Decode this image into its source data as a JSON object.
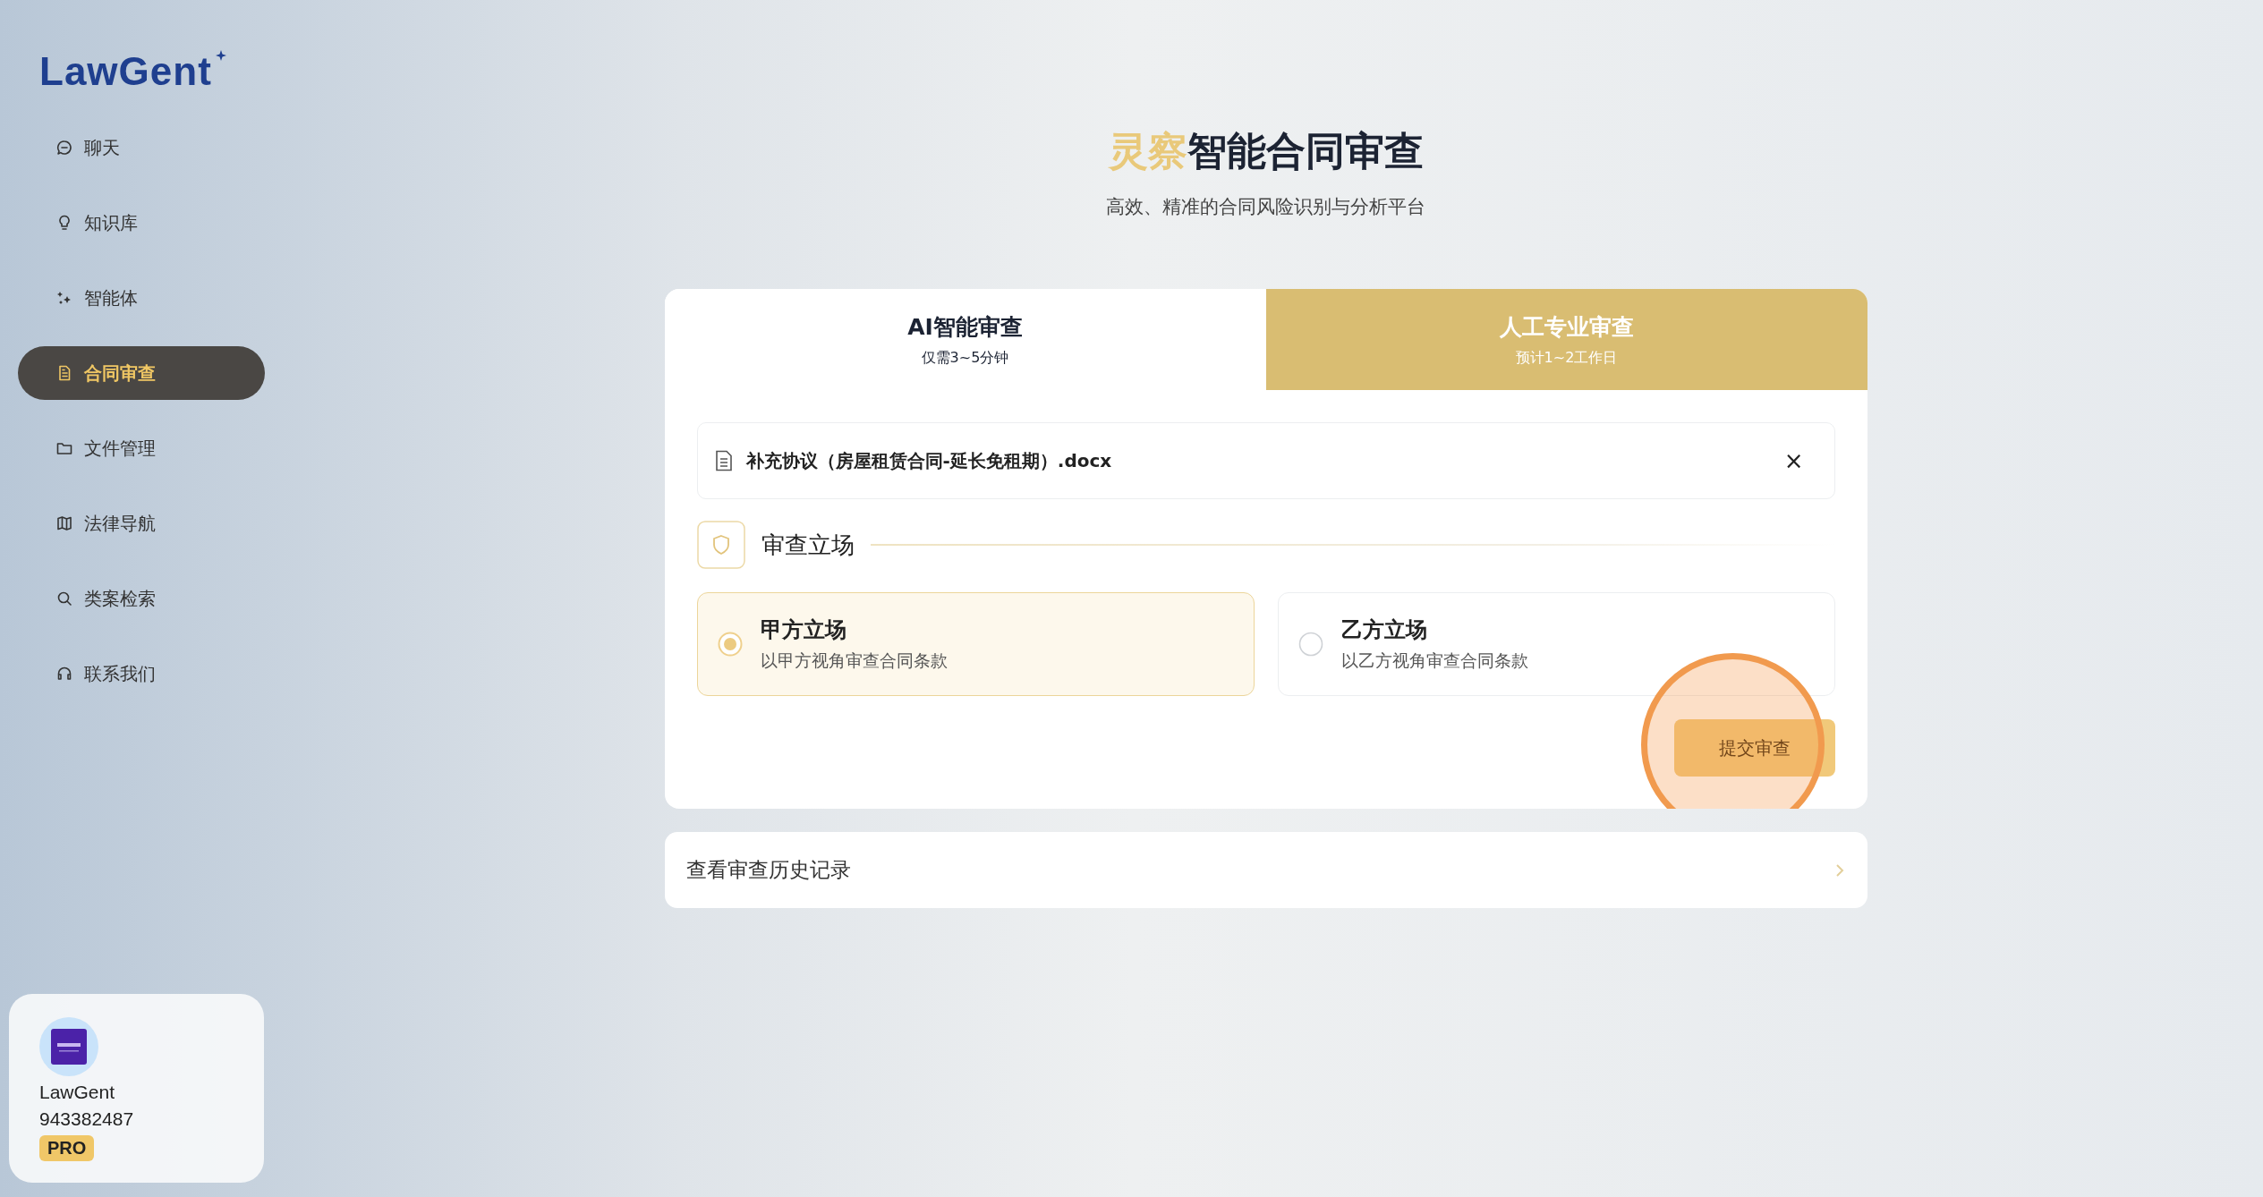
{
  "sidebar": {
    "logo": "LawGent",
    "items": [
      {
        "label": "聊天",
        "selected": false
      },
      {
        "label": "知识库",
        "selected": false
      },
      {
        "label": "智能体",
        "selected": false
      },
      {
        "label": "合同审查",
        "selected": true
      },
      {
        "label": "文件管理",
        "selected": false
      },
      {
        "label": "法律导航",
        "selected": false
      },
      {
        "label": "类案检索",
        "selected": false
      },
      {
        "label": "联系我们",
        "selected": false
      }
    ],
    "user": {
      "name": "LawGent",
      "id": "943382487",
      "badge": "PRO"
    }
  },
  "header": {
    "title_accent": "灵察",
    "title": "智能合同审查",
    "subtitle": "高效、精准的合同风险识别与分析平台"
  },
  "tabs": [
    {
      "label": "AI智能审查",
      "sublabel": "仅需3~5分钟",
      "selected": true
    },
    {
      "label": "人工专业审查",
      "sublabel": "预计1~2工作日",
      "selected": false
    }
  ],
  "file": {
    "name": "补充协议（房屋租赁合同-延长免租期）.docx",
    "remove": "×"
  },
  "stance": {
    "heading": "审查立场",
    "options": [
      {
        "label": "甲方立场",
        "description": "以甲方视角审查合同条款",
        "selected": true
      },
      {
        "label": "乙方立场",
        "description": "以乙方视角审查合同条款",
        "selected": false
      }
    ]
  },
  "submit": {
    "label": "提交审查",
    "highlighted": true
  },
  "history": {
    "label": "查看审查历史记录"
  }
}
